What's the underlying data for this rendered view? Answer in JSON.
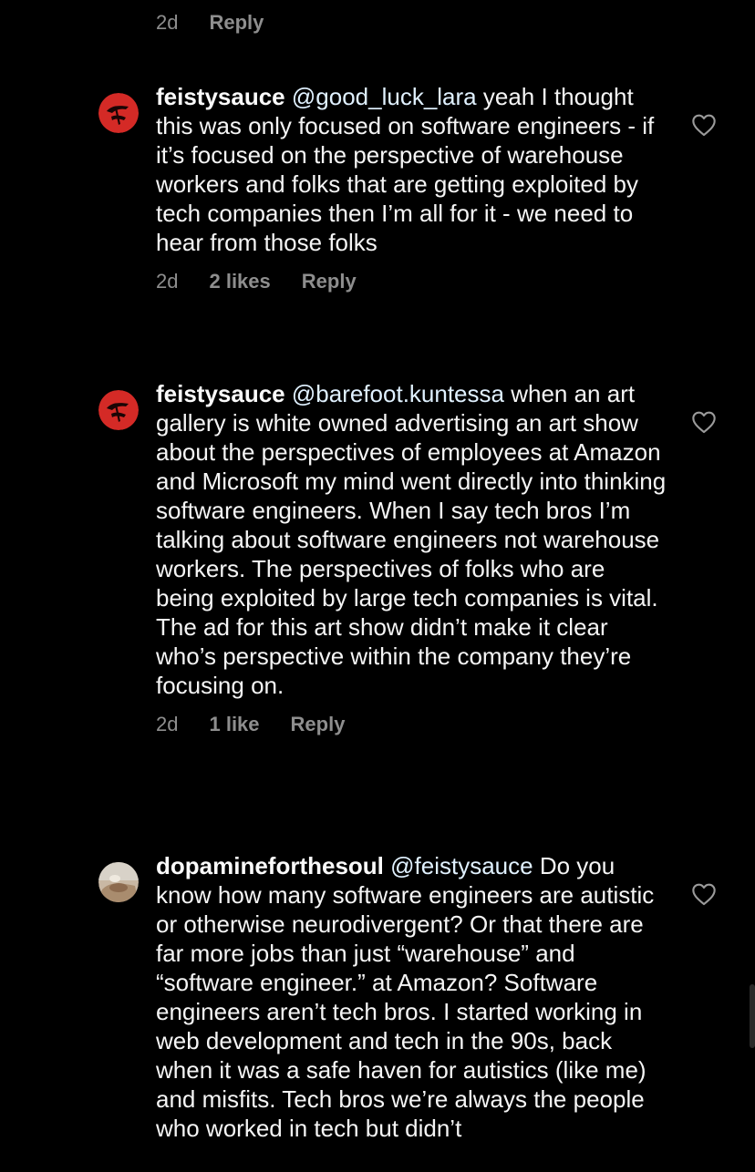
{
  "top_meta": {
    "time": "2d",
    "reply_label": "Reply"
  },
  "comments": [
    {
      "username": "feistysauce",
      "mention": "@good_luck_lara",
      "text": " yeah I thought this was only focused on software engineers - if it’s focused on the perspective of warehouse workers and folks that are getting exploited by tech companies then I’m all for it - we need to hear from those folks",
      "time": "2d",
      "likes": "2 likes",
      "reply_label": "Reply",
      "avatar_icon": "red-figure-avatar",
      "like_icon": "heart-outline-icon"
    },
    {
      "username": "feistysauce",
      "mention": "@barefoot.kuntessa",
      "text": " when an art gallery is white owned advertising an art show about the perspectives of employees at Amazon and Microsoft my mind went directly into thinking software engineers. When I say tech bros I’m talking about software engineers not warehouse workers. The perspectives of folks who are being exploited by large tech companies is vital. The ad for this art show didn’t make it clear who’s perspective within the company they’re focusing on.",
      "time": "2d",
      "likes": "1 like",
      "reply_label": "Reply",
      "avatar_icon": "red-figure-avatar",
      "like_icon": "heart-outline-icon"
    },
    {
      "username": "dopamineforthesoul",
      "mention": "@feistysauce",
      "text": " Do you know how many software engineers are autistic or otherwise neurodivergent? Or that there are far more jobs than just “warehouse” and “software engineer.” at Amazon? Software engineers aren’t tech bros. I started working in web development and tech in the 90s, back when it was a safe haven for autistics (like me) and misfits. Tech bros we’re always the people who worked in tech but didn’t",
      "avatar_icon": "photo-avatar",
      "like_icon": "heart-outline-icon"
    }
  ],
  "colors": {
    "background": "#000000",
    "text": "#f5f5f5",
    "secondary": "#8e8e8e",
    "mention": "#e0f1ff",
    "avatar_red": "#d42a26"
  }
}
